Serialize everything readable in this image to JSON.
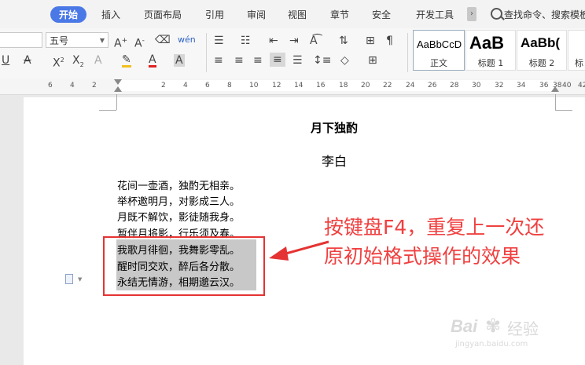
{
  "menubar": {
    "tabs": [
      {
        "label": "开始",
        "active": true
      },
      {
        "label": "插入"
      },
      {
        "label": "页面布局"
      },
      {
        "label": "引用"
      },
      {
        "label": "审阅"
      },
      {
        "label": "视图"
      },
      {
        "label": "章节"
      },
      {
        "label": "安全"
      },
      {
        "label": "开发工具"
      }
    ],
    "more_icon": "›",
    "search_text": "查找命令、搜索模板"
  },
  "toolbar": {
    "font_size": "五号",
    "styles": [
      {
        "sample": "AaBbCcD",
        "name": "正文"
      },
      {
        "sample": "AaB",
        "name": "标题 1"
      },
      {
        "sample": "AaBb(",
        "name": "标题 2"
      },
      {
        "sample": "",
        "name": "标"
      }
    ]
  },
  "ruler": {
    "ticks": [
      "6",
      "4",
      "2",
      "2",
      "4",
      "6",
      "8",
      "10",
      "12",
      "14",
      "16",
      "18",
      "20",
      "22",
      "24",
      "26",
      "28",
      "30",
      "32",
      "34",
      "36",
      "38",
      "40",
      "42"
    ]
  },
  "document": {
    "title": "月下独酌",
    "author": "李白",
    "lines": [
      "花间一壶酒，独酌无相亲。",
      "举杯邀明月，对影成三人。",
      "月既不解饮，影徒随我身。",
      "暂伴月将影，行乐须及春。",
      "我歌月徘徊，我舞影零乱。",
      "醒时同交欢，醉后各分散。",
      "永结无情游，相期邈云汉。"
    ]
  },
  "annotation": {
    "line1": "按键盘F4，重复上一次还",
    "line2": "原初始格式操作的效果",
    "color": "#f04040"
  },
  "watermark": {
    "brand": "Bai",
    "brand2": "经验",
    "url": "jingyan.baidu.com"
  }
}
